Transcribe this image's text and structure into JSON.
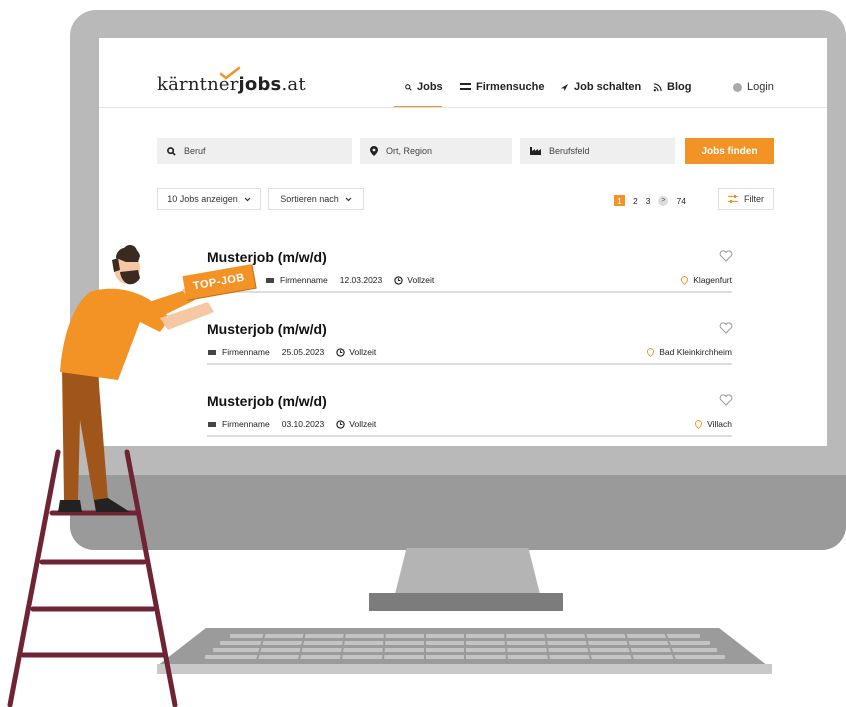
{
  "header": {
    "logo_prefix": "kärntner",
    "logo_bold": "jobs",
    "logo_suffix": ".at",
    "nav": [
      {
        "label": "Jobs",
        "icon": "search-icon"
      },
      {
        "label": "Firmensuche",
        "icon": "list-icon"
      },
      {
        "label": "Job schalten",
        "icon": "send-icon"
      },
      {
        "label": "Blog",
        "icon": "rss-icon"
      }
    ],
    "login": "Login",
    "active_nav": "Jobs",
    "accent_color": "#f39325"
  },
  "search": {
    "job_placeholder": "Beruf",
    "location_placeholder": "Ort, Region",
    "field_placeholder": "Berufsfeld",
    "submit_label": "Jobs finden"
  },
  "toolbar": {
    "per_page": "10 Jobs anzeigen",
    "sort": "Sortieren nach",
    "pages": [
      "1",
      "2",
      "3",
      "74"
    ],
    "current_page": "1",
    "filter": "Filter"
  },
  "jobs": [
    {
      "title": "Musterjob (m/w/d)",
      "company": "Firmenname",
      "date": "12.03.2023",
      "type": "Vollzeit",
      "location": "Klagenfurt",
      "badge": "TOP-JOB"
    },
    {
      "title": "Musterjob (m/w/d)",
      "company": "Firmenname",
      "date": "25.05.2023",
      "type": "Vollzeit",
      "location": "Bad Kleinkirchheim"
    },
    {
      "title": "Musterjob (m/w/d)",
      "company": "Firmenname",
      "date": "03.10.2023",
      "type": "Vollzeit",
      "location": "Villach"
    }
  ]
}
